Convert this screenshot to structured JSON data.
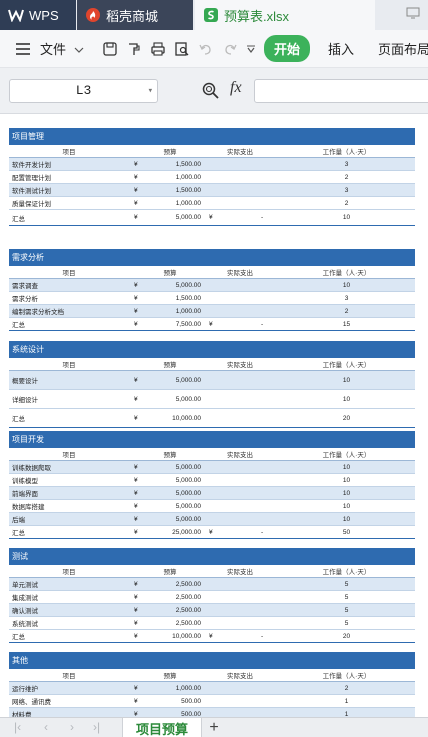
{
  "tabs": [
    {
      "label": "WPS"
    },
    {
      "label": "稻壳商城"
    },
    {
      "label": "预算表.xlsx"
    }
  ],
  "ribbon": {
    "file_label": "文件",
    "start_label": "开始",
    "insert_label": "插入",
    "layout_label": "页面布局"
  },
  "formula_bar": {
    "cell_ref": "L3",
    "fx_label": "fx",
    "value": ""
  },
  "sheet_tab": {
    "label": "项目预算"
  },
  "columns": {
    "name": "项目",
    "budget": "预算",
    "actual": "实际支出",
    "work": "工作量（人·天）"
  },
  "currency": "¥",
  "sections": [
    {
      "title": "项目管理",
      "rows": [
        {
          "name": "软件开发计划",
          "budget": "1,500.00",
          "work": "3"
        },
        {
          "name": "配置管理计划",
          "budget": "1,000.00",
          "work": "2"
        },
        {
          "name": "软件测试计划",
          "budget": "1,500.00",
          "work": "3"
        },
        {
          "name": "质量保证计划",
          "budget": "1,000.00",
          "work": "2"
        }
      ],
      "total": {
        "name": "汇总",
        "budget": "5,000.00",
        "actual": "-",
        "work": "10"
      }
    },
    {
      "title": "需求分析",
      "rows": [
        {
          "name": "需求调查",
          "budget": "5,000.00",
          "work": "10"
        },
        {
          "name": "需求分析",
          "budget": "1,500.00",
          "work": "3"
        },
        {
          "name": "编制需求分析文档",
          "budget": "1,000.00",
          "work": "2"
        }
      ],
      "total": {
        "name": "汇总",
        "budget": "7,500.00",
        "actual": "-",
        "work": "15"
      }
    },
    {
      "title": "系统设计",
      "rows": [
        {
          "name": "概要设计",
          "budget": "5,000.00",
          "work": "10"
        },
        {
          "name": "详细设计",
          "budget": "5,000.00",
          "work": "10"
        }
      ],
      "total": {
        "name": "汇总",
        "budget": "10,000.00",
        "work": "20"
      }
    },
    {
      "title": "项目开发",
      "rows": [
        {
          "name": "训练数据爬取",
          "budget": "5,000.00",
          "work": "10"
        },
        {
          "name": "训练模型",
          "budget": "5,000.00",
          "work": "10"
        },
        {
          "name": "前端界面",
          "budget": "5,000.00",
          "work": "10"
        },
        {
          "name": "数据库搭建",
          "budget": "5,000.00",
          "work": "10"
        },
        {
          "name": "后端",
          "budget": "5,000.00",
          "work": "10"
        }
      ],
      "total": {
        "name": "汇总",
        "budget": "25,000.00",
        "actual": "-",
        "work": "50"
      }
    },
    {
      "title": "测试",
      "rows": [
        {
          "name": "单元测试",
          "budget": "2,500.00",
          "work": "5"
        },
        {
          "name": "集成测试",
          "budget": "2,500.00",
          "work": "5"
        },
        {
          "name": "确认测试",
          "budget": "2,500.00",
          "work": "5"
        },
        {
          "name": "系统测试",
          "budget": "2,500.00",
          "work": "5"
        }
      ],
      "total": {
        "name": "汇总",
        "budget": "10,000.00",
        "actual": "-",
        "work": "20"
      }
    },
    {
      "title": "其他",
      "rows": [
        {
          "name": "运行维护",
          "budget": "1,000.00",
          "work": "2"
        },
        {
          "name": "网络、通讯费",
          "budget": "500.00",
          "work": "1"
        },
        {
          "name": "材料费",
          "budget": "500.00",
          "work": "1"
        }
      ]
    }
  ]
}
